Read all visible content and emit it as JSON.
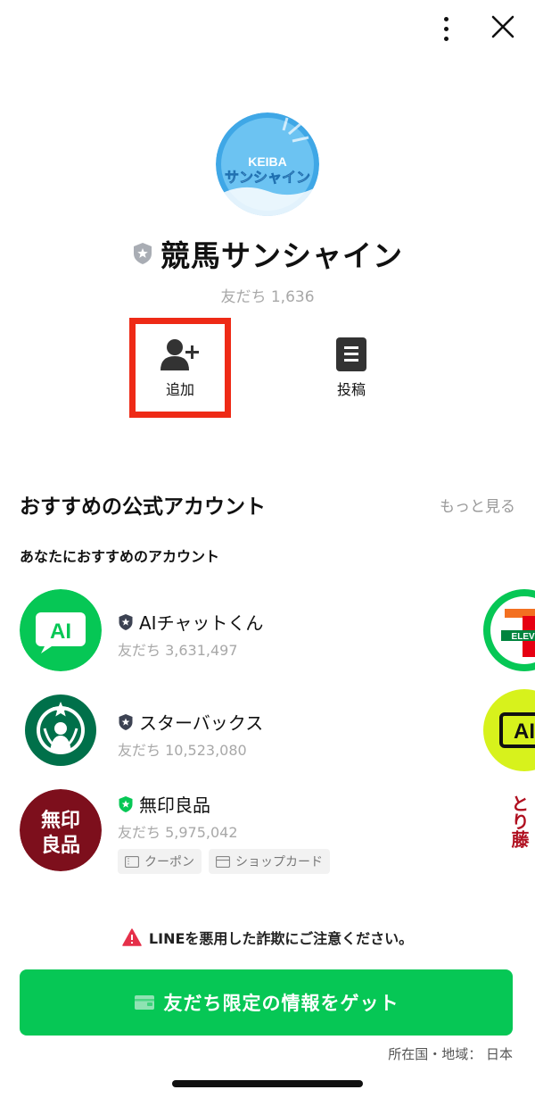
{
  "top": {
    "menu_icon": "kebab-menu-icon",
    "close_icon": "close-icon"
  },
  "profile": {
    "avatar_text_top": "KEIBA",
    "avatar_text_main": "サンシャイン",
    "name": "競馬サンシャイン",
    "friends": "友だち 1,636"
  },
  "actions": {
    "add_label": "追加",
    "post_label": "投稿"
  },
  "recommend": {
    "title": "おすすめの公式アカウント",
    "see_more": "もっと見る",
    "subtitle": "あなたにおすすめのアカウント",
    "accounts": [
      {
        "name": "AIチャットくん",
        "friends": "友だち 3,631,497",
        "logo_text": "AI",
        "badge": "gray"
      },
      {
        "name": "スターバックス",
        "friends": "友だち 10,523,080",
        "badge": "gray"
      },
      {
        "name": "無印良品",
        "friends": "友だち 5,975,042",
        "logo_line1": "無印",
        "logo_line2": "良品",
        "badge": "green",
        "tags": [
          {
            "label": "クーポン",
            "icon": "coupon-icon"
          },
          {
            "label": "ショップカード",
            "icon": "shop-card-icon"
          }
        ]
      }
    ],
    "side": {
      "seven_text": "ELEVI",
      "ai_text": "AI",
      "tori_text": "とり藤"
    }
  },
  "warning": "LINEを悪用した詐欺にご注意ください。",
  "cta": {
    "label": "友だち限定の情報をゲット"
  },
  "region": "所在国・地域： 日本",
  "colors": {
    "line_green": "#06c755",
    "highlight_red": "#ee2a16",
    "muji_red": "#7d0f1c",
    "starbucks_green": "#00704a"
  }
}
